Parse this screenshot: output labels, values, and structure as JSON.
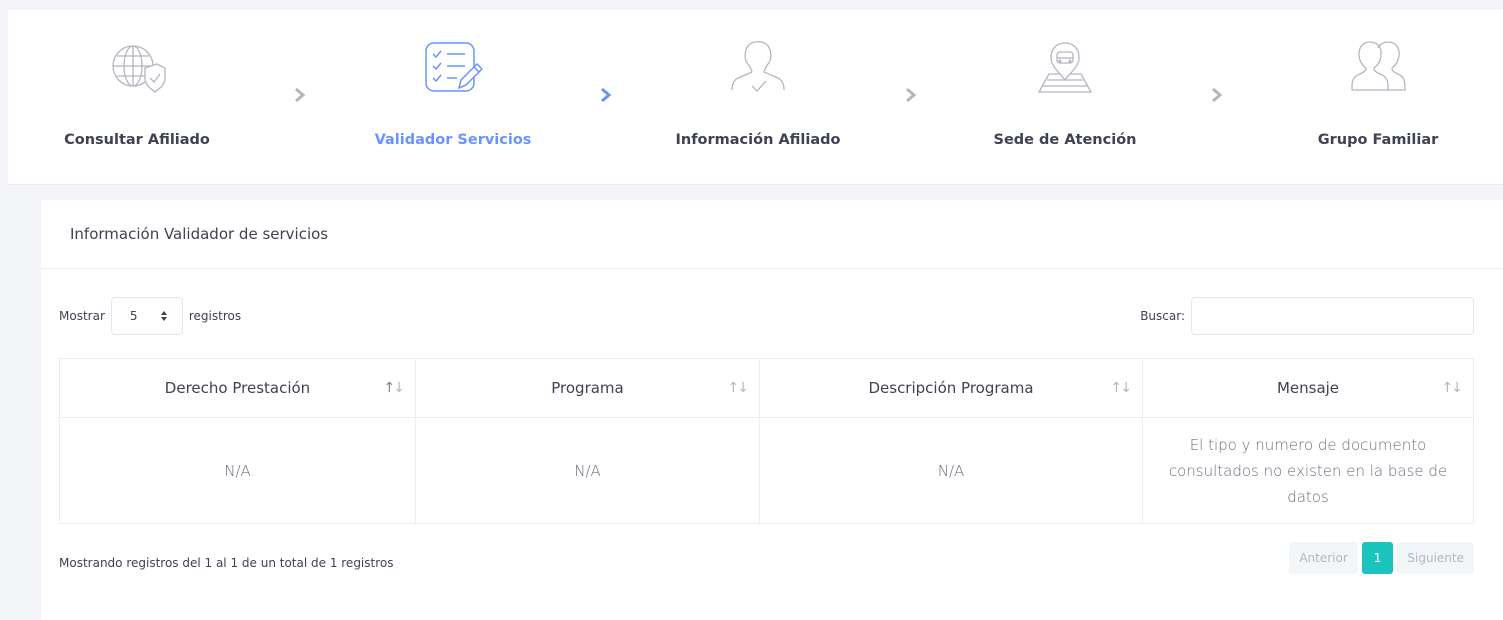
{
  "wizard": {
    "steps": [
      {
        "label": "Consultar Afiliado",
        "icon": "globe-shield-icon",
        "active": false
      },
      {
        "label": "Validador Servicios",
        "icon": "checklist-icon",
        "active": true
      },
      {
        "label": "Información Afiliado",
        "icon": "person-check-icon",
        "active": false
      },
      {
        "label": "Sede de Atención",
        "icon": "map-location-icon",
        "active": false
      },
      {
        "label": "Grupo Familiar",
        "icon": "group-icon",
        "active": false
      }
    ],
    "accent": "#6993ff",
    "arrow_color": "#b5b5c3"
  },
  "card": {
    "title": "Información Validador de servicios"
  },
  "table_controls": {
    "show_label": "Mostrar",
    "page_size": "5",
    "records_label": "registros",
    "search_label": "Buscar:",
    "search_value": ""
  },
  "table": {
    "columns": [
      "Derecho Prestación",
      "Programa",
      "Descripción Programa",
      "Mensaje"
    ],
    "rows": [
      [
        "N/A",
        "N/A",
        "N/A",
        "El tipo y numero de documento consultados no existen en la base de datos"
      ]
    ]
  },
  "footer": {
    "info": "Mostrando registros del 1 al 1 de un total de 1 registros",
    "prev_label": "Anterior",
    "current_page": "1",
    "next_label": "Siguiente",
    "page_color": "#1bc5bd"
  }
}
